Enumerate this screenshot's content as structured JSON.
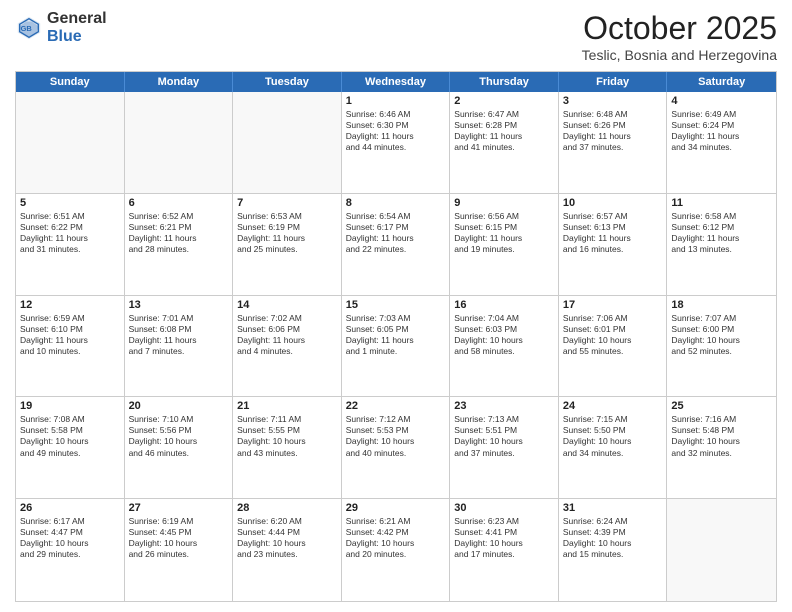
{
  "logo": {
    "general": "General",
    "blue": "Blue"
  },
  "title": "October 2025",
  "subtitle": "Teslic, Bosnia and Herzegovina",
  "days": [
    "Sunday",
    "Monday",
    "Tuesday",
    "Wednesday",
    "Thursday",
    "Friday",
    "Saturday"
  ],
  "weeks": [
    [
      {
        "day": "",
        "empty": true
      },
      {
        "day": "",
        "empty": true
      },
      {
        "day": "",
        "empty": true
      },
      {
        "day": "1",
        "lines": [
          "Sunrise: 6:46 AM",
          "Sunset: 6:30 PM",
          "Daylight: 11 hours",
          "and 44 minutes."
        ]
      },
      {
        "day": "2",
        "lines": [
          "Sunrise: 6:47 AM",
          "Sunset: 6:28 PM",
          "Daylight: 11 hours",
          "and 41 minutes."
        ]
      },
      {
        "day": "3",
        "lines": [
          "Sunrise: 6:48 AM",
          "Sunset: 6:26 PM",
          "Daylight: 11 hours",
          "and 37 minutes."
        ]
      },
      {
        "day": "4",
        "lines": [
          "Sunrise: 6:49 AM",
          "Sunset: 6:24 PM",
          "Daylight: 11 hours",
          "and 34 minutes."
        ]
      }
    ],
    [
      {
        "day": "5",
        "lines": [
          "Sunrise: 6:51 AM",
          "Sunset: 6:22 PM",
          "Daylight: 11 hours",
          "and 31 minutes."
        ]
      },
      {
        "day": "6",
        "lines": [
          "Sunrise: 6:52 AM",
          "Sunset: 6:21 PM",
          "Daylight: 11 hours",
          "and 28 minutes."
        ]
      },
      {
        "day": "7",
        "lines": [
          "Sunrise: 6:53 AM",
          "Sunset: 6:19 PM",
          "Daylight: 11 hours",
          "and 25 minutes."
        ]
      },
      {
        "day": "8",
        "lines": [
          "Sunrise: 6:54 AM",
          "Sunset: 6:17 PM",
          "Daylight: 11 hours",
          "and 22 minutes."
        ]
      },
      {
        "day": "9",
        "lines": [
          "Sunrise: 6:56 AM",
          "Sunset: 6:15 PM",
          "Daylight: 11 hours",
          "and 19 minutes."
        ]
      },
      {
        "day": "10",
        "lines": [
          "Sunrise: 6:57 AM",
          "Sunset: 6:13 PM",
          "Daylight: 11 hours",
          "and 16 minutes."
        ]
      },
      {
        "day": "11",
        "lines": [
          "Sunrise: 6:58 AM",
          "Sunset: 6:12 PM",
          "Daylight: 11 hours",
          "and 13 minutes."
        ]
      }
    ],
    [
      {
        "day": "12",
        "lines": [
          "Sunrise: 6:59 AM",
          "Sunset: 6:10 PM",
          "Daylight: 11 hours",
          "and 10 minutes."
        ]
      },
      {
        "day": "13",
        "lines": [
          "Sunrise: 7:01 AM",
          "Sunset: 6:08 PM",
          "Daylight: 11 hours",
          "and 7 minutes."
        ]
      },
      {
        "day": "14",
        "lines": [
          "Sunrise: 7:02 AM",
          "Sunset: 6:06 PM",
          "Daylight: 11 hours",
          "and 4 minutes."
        ]
      },
      {
        "day": "15",
        "lines": [
          "Sunrise: 7:03 AM",
          "Sunset: 6:05 PM",
          "Daylight: 11 hours",
          "and 1 minute."
        ]
      },
      {
        "day": "16",
        "lines": [
          "Sunrise: 7:04 AM",
          "Sunset: 6:03 PM",
          "Daylight: 10 hours",
          "and 58 minutes."
        ]
      },
      {
        "day": "17",
        "lines": [
          "Sunrise: 7:06 AM",
          "Sunset: 6:01 PM",
          "Daylight: 10 hours",
          "and 55 minutes."
        ]
      },
      {
        "day": "18",
        "lines": [
          "Sunrise: 7:07 AM",
          "Sunset: 6:00 PM",
          "Daylight: 10 hours",
          "and 52 minutes."
        ]
      }
    ],
    [
      {
        "day": "19",
        "lines": [
          "Sunrise: 7:08 AM",
          "Sunset: 5:58 PM",
          "Daylight: 10 hours",
          "and 49 minutes."
        ]
      },
      {
        "day": "20",
        "lines": [
          "Sunrise: 7:10 AM",
          "Sunset: 5:56 PM",
          "Daylight: 10 hours",
          "and 46 minutes."
        ]
      },
      {
        "day": "21",
        "lines": [
          "Sunrise: 7:11 AM",
          "Sunset: 5:55 PM",
          "Daylight: 10 hours",
          "and 43 minutes."
        ]
      },
      {
        "day": "22",
        "lines": [
          "Sunrise: 7:12 AM",
          "Sunset: 5:53 PM",
          "Daylight: 10 hours",
          "and 40 minutes."
        ]
      },
      {
        "day": "23",
        "lines": [
          "Sunrise: 7:13 AM",
          "Sunset: 5:51 PM",
          "Daylight: 10 hours",
          "and 37 minutes."
        ]
      },
      {
        "day": "24",
        "lines": [
          "Sunrise: 7:15 AM",
          "Sunset: 5:50 PM",
          "Daylight: 10 hours",
          "and 34 minutes."
        ]
      },
      {
        "day": "25",
        "lines": [
          "Sunrise: 7:16 AM",
          "Sunset: 5:48 PM",
          "Daylight: 10 hours",
          "and 32 minutes."
        ]
      }
    ],
    [
      {
        "day": "26",
        "lines": [
          "Sunrise: 6:17 AM",
          "Sunset: 4:47 PM",
          "Daylight: 10 hours",
          "and 29 minutes."
        ]
      },
      {
        "day": "27",
        "lines": [
          "Sunrise: 6:19 AM",
          "Sunset: 4:45 PM",
          "Daylight: 10 hours",
          "and 26 minutes."
        ]
      },
      {
        "day": "28",
        "lines": [
          "Sunrise: 6:20 AM",
          "Sunset: 4:44 PM",
          "Daylight: 10 hours",
          "and 23 minutes."
        ]
      },
      {
        "day": "29",
        "lines": [
          "Sunrise: 6:21 AM",
          "Sunset: 4:42 PM",
          "Daylight: 10 hours",
          "and 20 minutes."
        ]
      },
      {
        "day": "30",
        "lines": [
          "Sunrise: 6:23 AM",
          "Sunset: 4:41 PM",
          "Daylight: 10 hours",
          "and 17 minutes."
        ]
      },
      {
        "day": "31",
        "lines": [
          "Sunrise: 6:24 AM",
          "Sunset: 4:39 PM",
          "Daylight: 10 hours",
          "and 15 minutes."
        ]
      },
      {
        "day": "",
        "empty": true
      }
    ]
  ]
}
